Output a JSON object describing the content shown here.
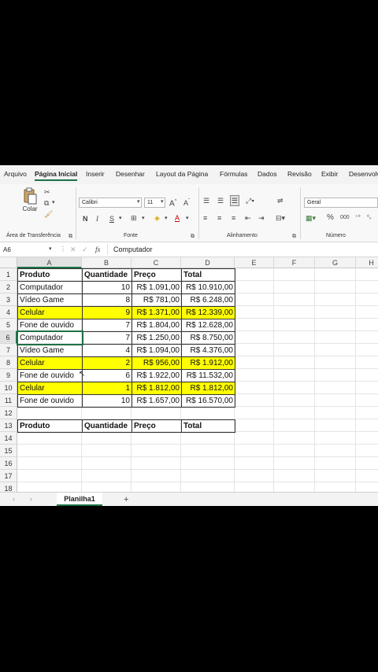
{
  "ribbon_tabs": [
    "Arquivo",
    "Página Inicial",
    "Inserir",
    "Desenhar",
    "Layout da Página",
    "Fórmulas",
    "Dados",
    "Revisão",
    "Exibir",
    "Desenvolv"
  ],
  "active_tab": "Página Inicial",
  "clipboard": {
    "paste_label": "Colar",
    "group_label": "Área de Transferência"
  },
  "font": {
    "name": "Calibri",
    "size": "11",
    "group_label": "Fonte",
    "bold": "N",
    "italic": "I",
    "underline": "S"
  },
  "alignment": {
    "group_label": "Alinhamento"
  },
  "number": {
    "format": "Geral",
    "group_label": "Número",
    "percent": "%"
  },
  "formula_bar": {
    "name_box": "A6",
    "fx": "fx",
    "content": "Computador"
  },
  "columns": [
    "A",
    "B",
    "C",
    "D",
    "E",
    "F",
    "G",
    "H"
  ],
  "rows": [
    "1",
    "2",
    "3",
    "4",
    "5",
    "6",
    "7",
    "8",
    "9",
    "10",
    "11",
    "12",
    "13",
    "14",
    "15",
    "16",
    "17",
    "18"
  ],
  "table": {
    "headers": [
      "Produto",
      "Quantidade",
      "Preço",
      "Total"
    ],
    "rows": [
      {
        "produto": "Computador",
        "qtd": "10",
        "preco": "R$ 1.091,00",
        "total": "R$ 10.910,00",
        "highlight": false
      },
      {
        "produto": "Vídeo Game",
        "qtd": "8",
        "preco": "R$ 781,00",
        "total": "R$ 6.248,00",
        "highlight": false
      },
      {
        "produto": "Celular",
        "qtd": "9",
        "preco": "R$ 1.371,00",
        "total": "R$ 12.339,00",
        "highlight": true
      },
      {
        "produto": "Fone de ouvido",
        "qtd": "7",
        "preco": "R$ 1.804,00",
        "total": "R$ 12.628,00",
        "highlight": false
      },
      {
        "produto": "Computador",
        "qtd": "7",
        "preco": "R$ 1.250,00",
        "total": "R$ 8.750,00",
        "highlight": false
      },
      {
        "produto": "Vídeo Game",
        "qtd": "4",
        "preco": "R$ 1.094,00",
        "total": "R$ 4.376,00",
        "highlight": false
      },
      {
        "produto": "Celular",
        "qtd": "2",
        "preco": "R$ 956,00",
        "total": "R$ 1.912,00",
        "highlight": true
      },
      {
        "produto": "Fone de ouvido",
        "qtd": "6",
        "preco": "R$ 1.922,00",
        "total": "R$ 11.532,00",
        "highlight": false
      },
      {
        "produto": "Celular",
        "qtd": "1",
        "preco": "R$ 1.812,00",
        "total": "R$ 1.812,00",
        "highlight": true
      },
      {
        "produto": "Fone de ouvido",
        "qtd": "10",
        "preco": "R$ 1.657,00",
        "total": "R$ 16.570,00",
        "highlight": false
      }
    ],
    "highlight_color": "#ffff00"
  },
  "criteria_headers": [
    "Produto",
    "Quantidade",
    "Preço",
    "Total"
  ],
  "sheet_tabs": {
    "active": "Planilha1",
    "add": "+"
  },
  "colors": {
    "accent": "#1e7145",
    "highlight": "#ffff00"
  }
}
